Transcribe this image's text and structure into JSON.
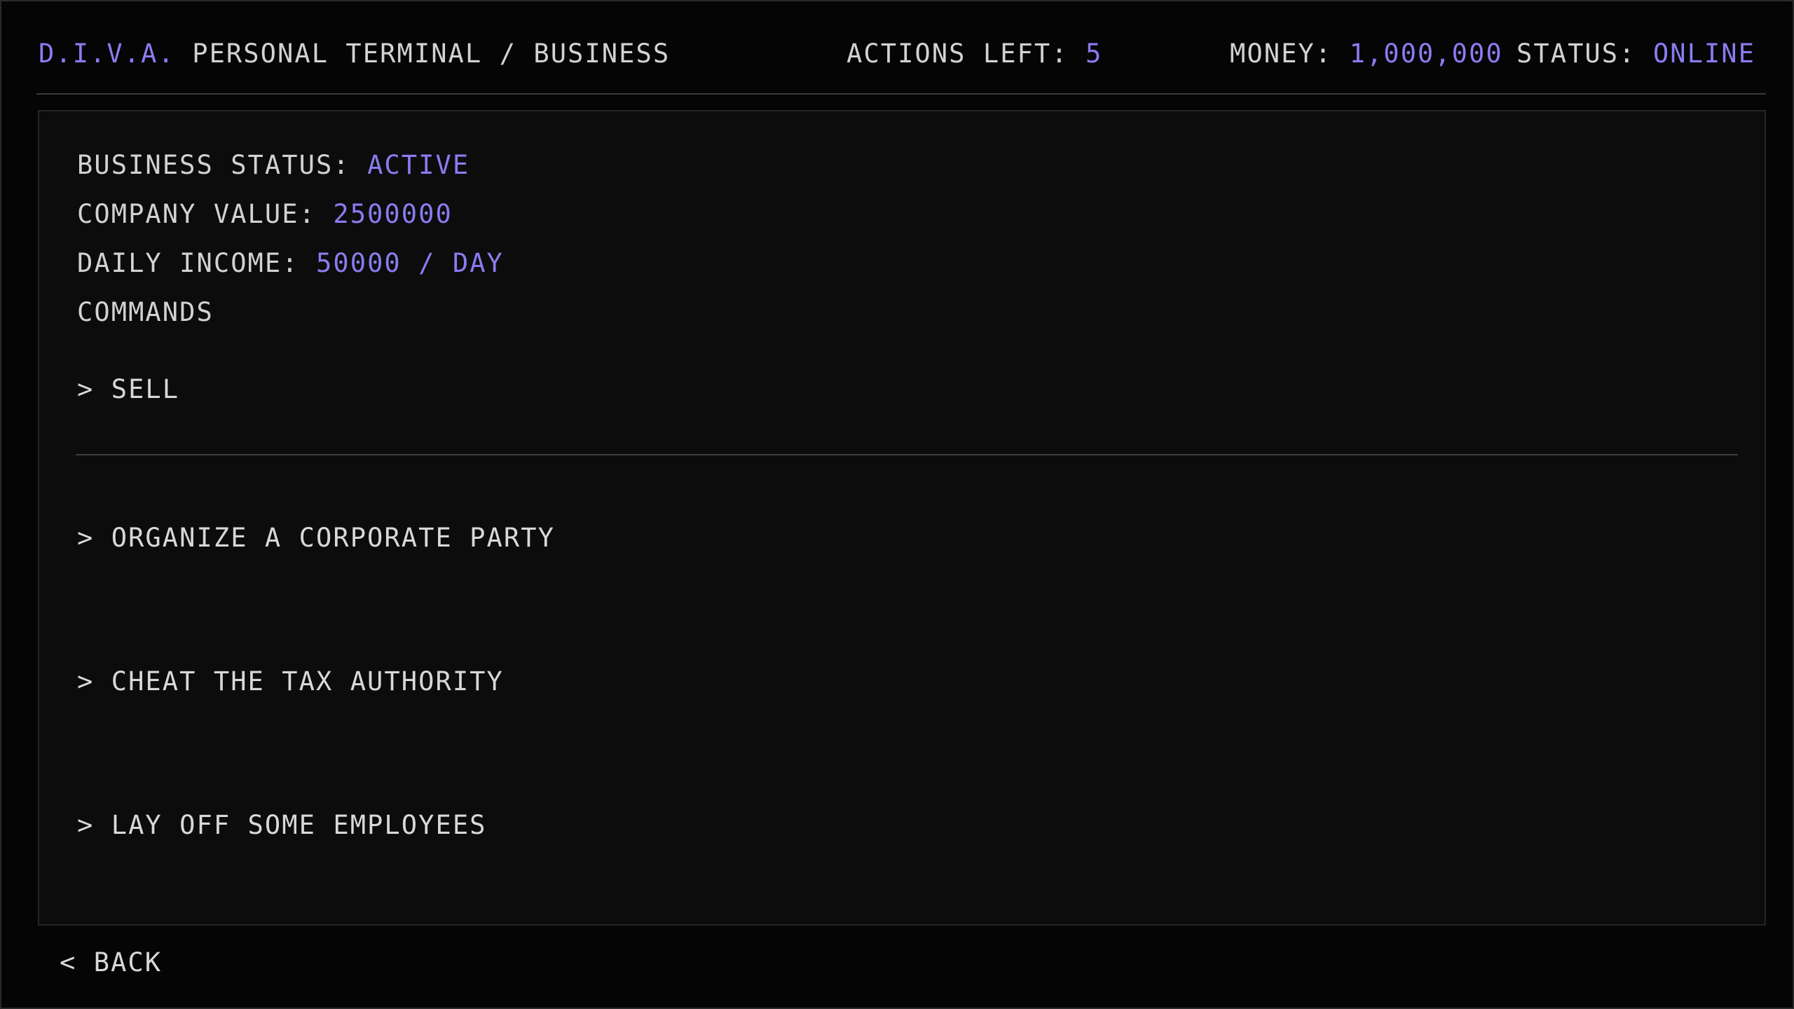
{
  "colors": {
    "accent": "#8a7cf0",
    "text": "#d2d2d2",
    "background": "#050505",
    "panel": "#0c0c0c"
  },
  "header": {
    "brand": "D.I.V.A.",
    "title": "PERSONAL TERMINAL / BUSINESS",
    "actions_label": "ACTIONS LEFT:",
    "actions_value": "5",
    "money_label": "MONEY:",
    "money_value": "1,000,000",
    "status_label": "STATUS:",
    "status_value": "ONLINE"
  },
  "business": {
    "status_label": "BUSINESS STATUS:",
    "status_value": "ACTIVE",
    "value_label": "COMPANY VALUE:",
    "value_value": "2500000",
    "income_label": "DAILY INCOME:",
    "income_value": "50000 / DAY",
    "commands_heading": "COMMANDS"
  },
  "commands": [
    {
      "label": "> SELL"
    },
    {
      "label": "> ORGANIZE A CORPORATE PARTY"
    },
    {
      "label": "> CHEAT THE TAX AUTHORITY"
    },
    {
      "label": "> LAY OFF SOME EMPLOYEES"
    }
  ],
  "footer": {
    "back_label": "< BACK"
  }
}
